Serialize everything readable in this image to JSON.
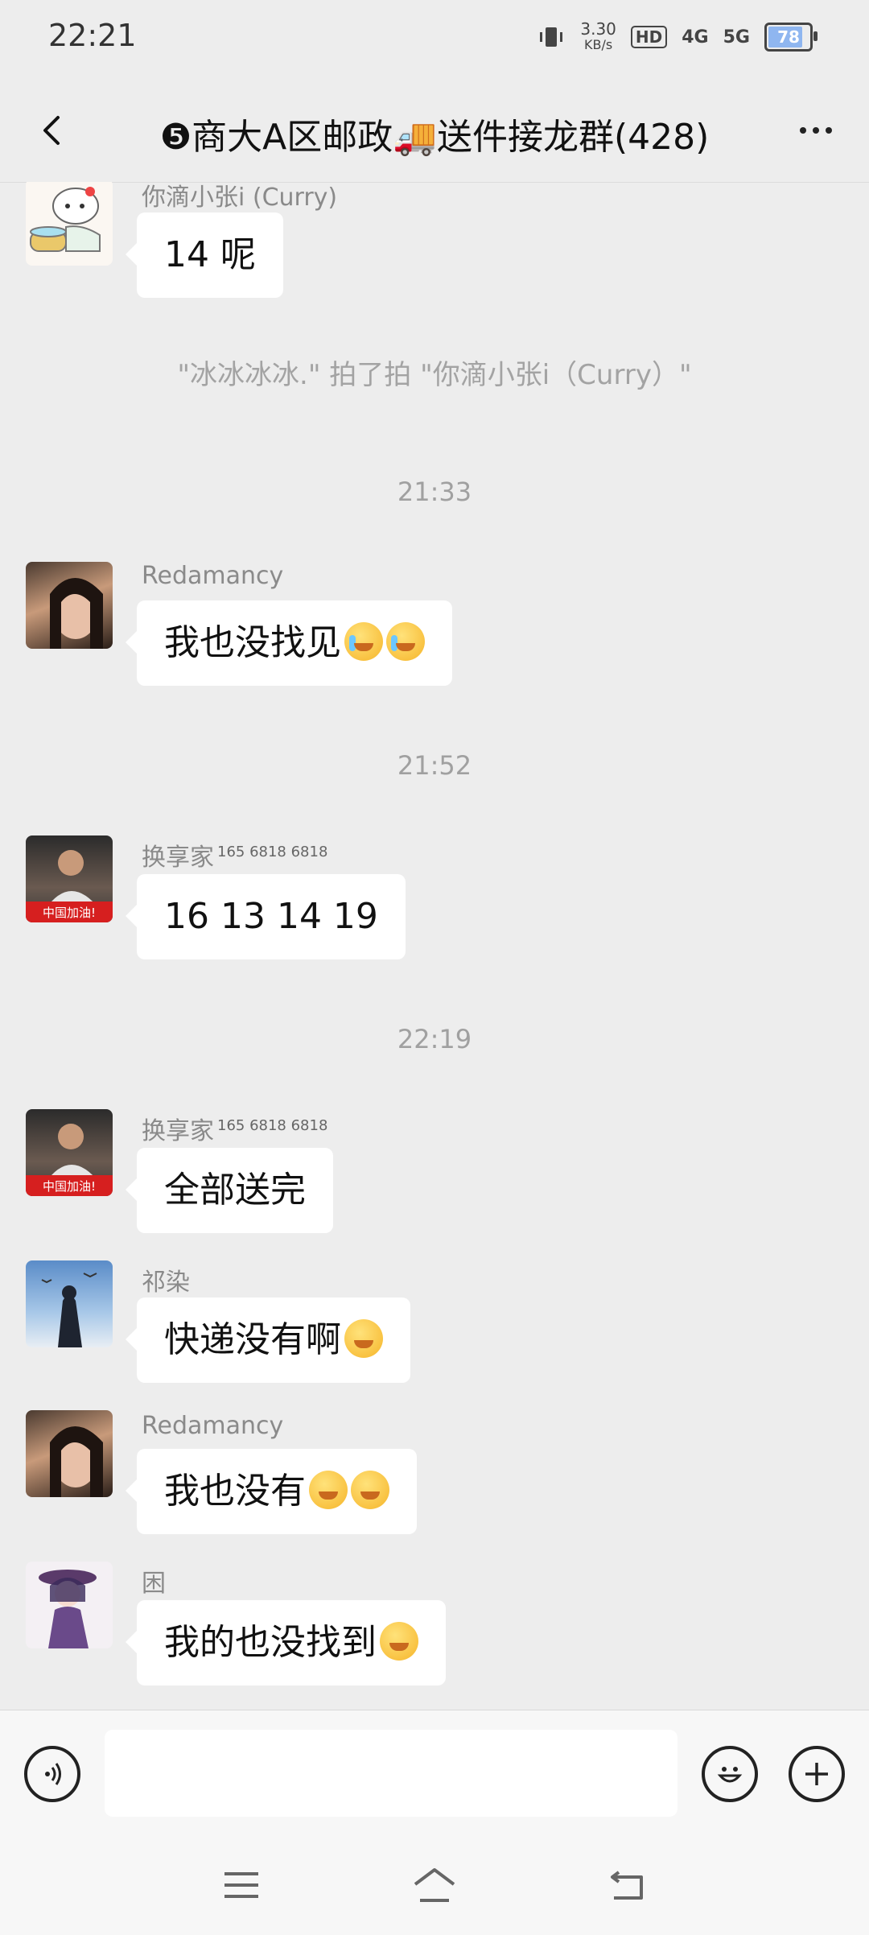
{
  "status_bar": {
    "time": "22:21",
    "speed_value": "3.30",
    "speed_unit": "KB/s",
    "hd_badge": "HD",
    "signal_4g": "4G",
    "signal_5g": "5G",
    "battery_level": "78"
  },
  "header": {
    "title": "❺商大A区邮政🚚送件接龙群(428)"
  },
  "messages": [
    {
      "sender": "你滴小张i (Curry)",
      "text": "14 呢"
    },
    {
      "system": "\"冰冰冰冰.\" 拍了拍 \"你滴小张i（Curry）\""
    },
    {
      "timestamp": "21:33"
    },
    {
      "sender": "Redamancy",
      "text": "我也没找见"
    },
    {
      "timestamp": "21:52"
    },
    {
      "sender": "换享家",
      "sender_sup": "165 6818 6818",
      "text": "16 13 14 19"
    },
    {
      "timestamp": "22:19"
    },
    {
      "sender": "换享家",
      "sender_sup": "165 6818 6818",
      "text": "全部送完"
    },
    {
      "sender": "祁染",
      "text": "快递没有啊"
    },
    {
      "sender": "Redamancy",
      "text": "我也没有"
    },
    {
      "sender": "困",
      "text": "我的也没找到"
    }
  ],
  "avatar_badge_text": "中国加油!",
  "input_bar": {
    "voice_icon": "voice-icon",
    "emoji_icon": "emoji-icon",
    "plus_icon": "plus-icon"
  },
  "nav_bar": {
    "menu_icon": "menu-icon",
    "home_icon": "home-icon",
    "back_icon": "back-icon"
  },
  "colors": {
    "background": "#ededed",
    "bubble": "#ffffff",
    "muted_text": "#8a8a8a"
  }
}
